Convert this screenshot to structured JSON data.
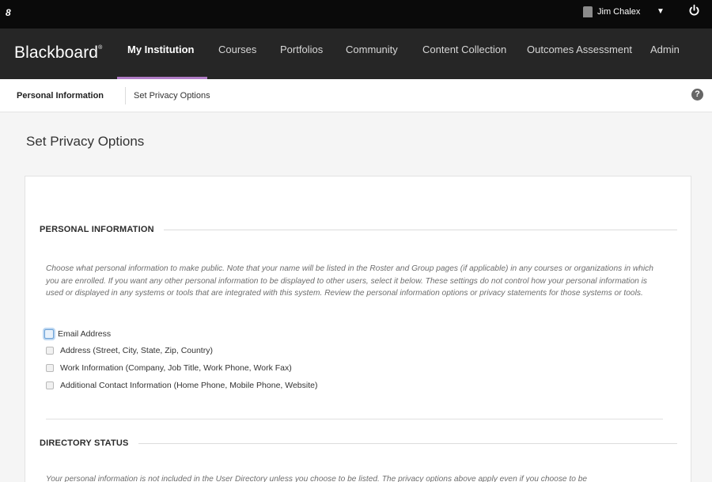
{
  "topbar": {
    "logo_glyph": "8",
    "user_name": "Jim Chalex",
    "icons": [
      "blackboard-mark-icon",
      "user-avatar-icon",
      "caret-down-icon",
      "power-icon"
    ]
  },
  "nav": {
    "brand": "Blackboard",
    "brand_mark": "®",
    "tabs": [
      {
        "label": "My Institution",
        "active": true
      },
      {
        "label": "Courses"
      },
      {
        "label": "Portfolios"
      },
      {
        "label": "Community"
      },
      {
        "label": "Content Collection"
      },
      {
        "label": "Outcomes Assessment"
      },
      {
        "label": "Admin"
      }
    ],
    "active_underline_color": "#b07cc6"
  },
  "breadcrumb": {
    "items": [
      "Personal Information",
      "Set Privacy Options"
    ],
    "help_glyph": "?"
  },
  "page_title": "Set Privacy Options",
  "personal_info": {
    "heading": "PERSONAL INFORMATION",
    "description": "Choose what personal information to make public. Note that your name will be listed in the Roster and Group pages (if applicable) in any courses or organizations in which you are enrolled. If you want any other personal information to be displayed to other users, select it below. These settings do not control how your personal information is used or displayed in any systems or tools that are integrated with this system. Review the personal information options or privacy statements for those systems or tools.",
    "options": [
      {
        "label": "Email Address",
        "checked": false
      },
      {
        "label": "Address (Street, City, State, Zip, Country)",
        "checked": false
      },
      {
        "label": "Work Information (Company, Job Title, Work Phone, Work Fax)",
        "checked": false
      },
      {
        "label": "Additional Contact Information (Home Phone, Mobile Phone, Website)",
        "checked": false
      }
    ]
  },
  "directory_status": {
    "heading": "DIRECTORY STATUS",
    "description": "Your personal information is not included in the User Directory unless you choose to be listed. The privacy options above apply even if you choose to be"
  }
}
